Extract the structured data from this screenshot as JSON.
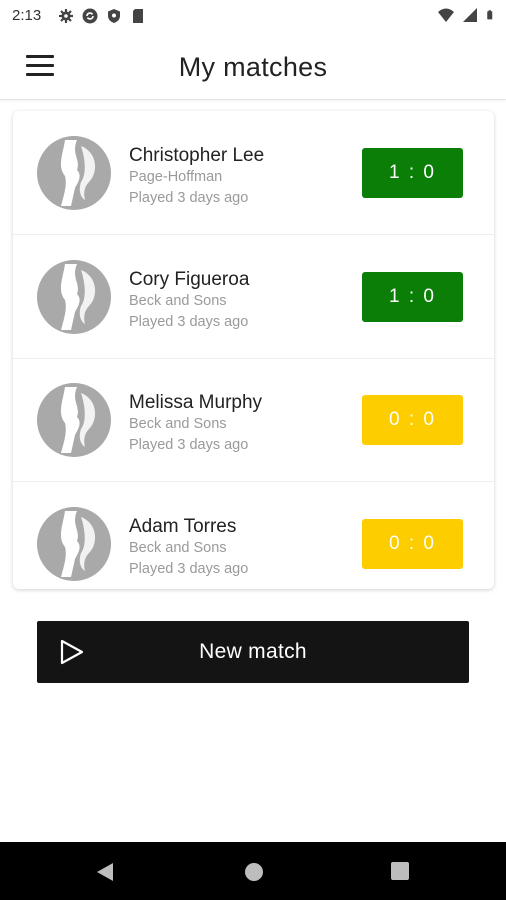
{
  "status_bar": {
    "time": "2:13",
    "left_icons": [
      "settings-icon",
      "sync-icon",
      "shield-icon",
      "sd-card-icon"
    ],
    "right_icons": [
      "wifi-icon",
      "signal-icon",
      "battery-icon"
    ]
  },
  "app_bar": {
    "title": "My matches",
    "menu_icon": "hamburger-menu-icon"
  },
  "matches": [
    {
      "name": "Christopher Lee",
      "team": "Page-Hoffman",
      "played": "Played 3 days ago",
      "score": "1 : 0",
      "result": "win"
    },
    {
      "name": "Cory Figueroa",
      "team": "Beck and Sons",
      "played": "Played 3 days ago",
      "score": "1 : 0",
      "result": "win"
    },
    {
      "name": "Melissa Murphy",
      "team": "Beck and Sons",
      "played": "Played 3 days ago",
      "score": "0 : 0",
      "result": "draw"
    },
    {
      "name": "Adam Torres",
      "team": "Beck and Sons",
      "played": "Played 3 days ago",
      "score": "0 : 0",
      "result": "draw"
    }
  ],
  "new_match_button": {
    "label": "New match",
    "icon": "play-icon"
  },
  "colors": {
    "win": "#0a7e07",
    "draw": "#fdcd00",
    "button_bg": "#141414",
    "avatar_gray": "#a9a9a9"
  },
  "nav_bar": {
    "buttons": [
      "back-icon",
      "home-icon",
      "recents-icon"
    ]
  }
}
